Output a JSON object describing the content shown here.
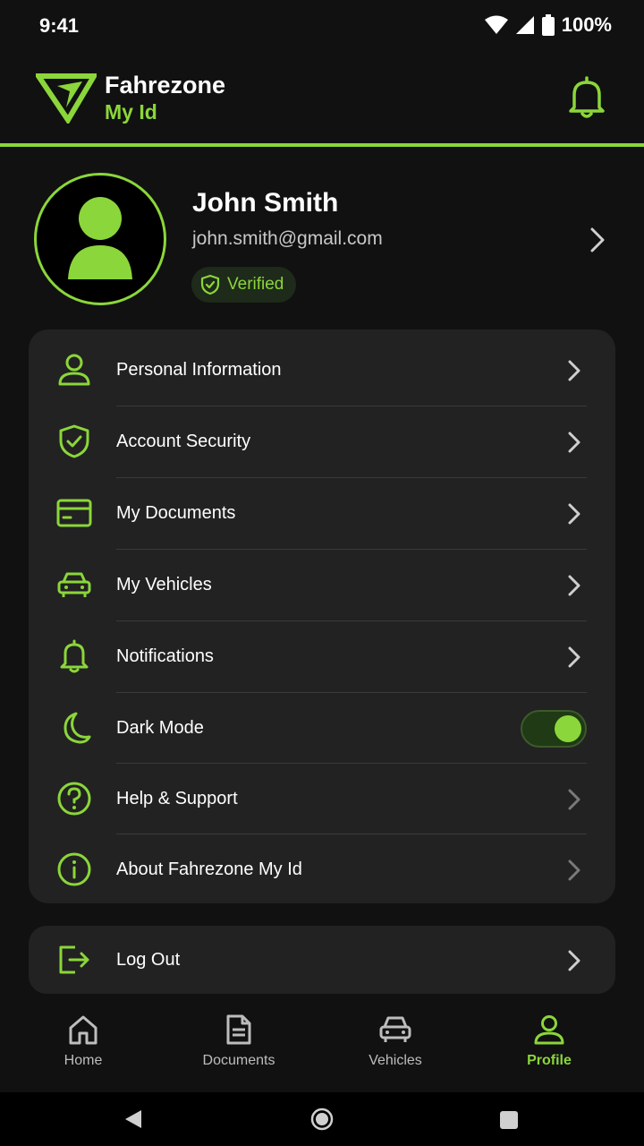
{
  "status_bar": {
    "time": "9:41",
    "battery": "100%"
  },
  "header": {
    "title": "Fahrezone",
    "subtitle": "My Id"
  },
  "profile": {
    "name": "John Smith",
    "email": "john.smith@gmail.com",
    "badge": "Verified"
  },
  "menu": {
    "items": [
      {
        "label": "Personal Information",
        "icon": "user-icon"
      },
      {
        "label": "Account Security",
        "icon": "shield-check-icon"
      },
      {
        "label": "My Documents",
        "icon": "card-icon"
      },
      {
        "label": "My Vehicles",
        "icon": "car-icon"
      },
      {
        "label": "Notifications",
        "icon": "bell-icon"
      },
      {
        "label": "Dark Mode",
        "icon": "moon-icon",
        "toggle": true
      },
      {
        "label": "Help & Support",
        "icon": "help-icon"
      },
      {
        "label": "About Fahrezone My Id",
        "icon": "info-icon"
      }
    ]
  },
  "logout": {
    "label": "Log Out"
  },
  "bottom_nav": {
    "items": [
      {
        "label": "Home",
        "icon": "home-icon"
      },
      {
        "label": "Documents",
        "icon": "document-icon"
      },
      {
        "label": "Vehicles",
        "icon": "car-icon"
      },
      {
        "label": "Profile",
        "icon": "user-icon",
        "active": true
      }
    ]
  },
  "colors": {
    "accent": "#8bd63a",
    "background": "#111111",
    "card": "#222222"
  }
}
